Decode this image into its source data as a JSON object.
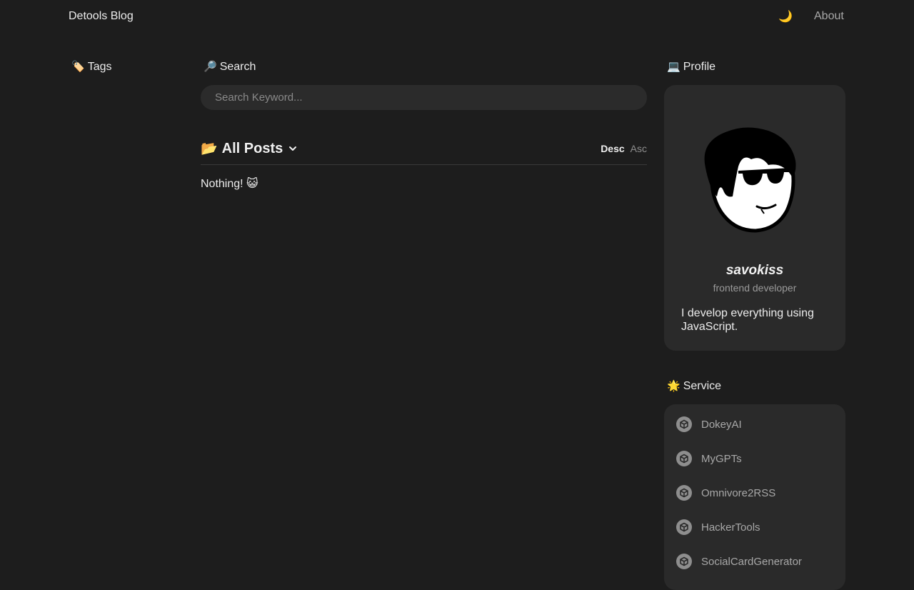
{
  "header": {
    "brand": "Detools Blog",
    "theme_icon": "🌙",
    "about_label": "About"
  },
  "tags": {
    "emoji": "🏷️",
    "title": "Tags"
  },
  "search": {
    "emoji": "🔎",
    "title": "Search",
    "placeholder": "Search Keyword...",
    "value": ""
  },
  "posts": {
    "emoji": "📂",
    "title": "All Posts",
    "sort_desc": "Desc",
    "sort_asc": "Asc",
    "active_sort": "Desc",
    "empty_message": "Nothing! 😺"
  },
  "profile": {
    "emoji": "💻",
    "title": "Profile",
    "name": "savokiss",
    "role": "frontend developer",
    "bio": "I develop everything using JavaScript."
  },
  "service": {
    "emoji": "🌟",
    "title": "Service",
    "items": [
      {
        "label": "DokeyAI"
      },
      {
        "label": "MyGPTs"
      },
      {
        "label": "Omnivore2RSS"
      },
      {
        "label": "HackerTools"
      },
      {
        "label": "SocialCardGenerator"
      }
    ]
  },
  "colors": {
    "background": "#1d1d1d",
    "card": "#2a2a2a",
    "text": "#ececec",
    "muted": "#9a9a9a"
  }
}
